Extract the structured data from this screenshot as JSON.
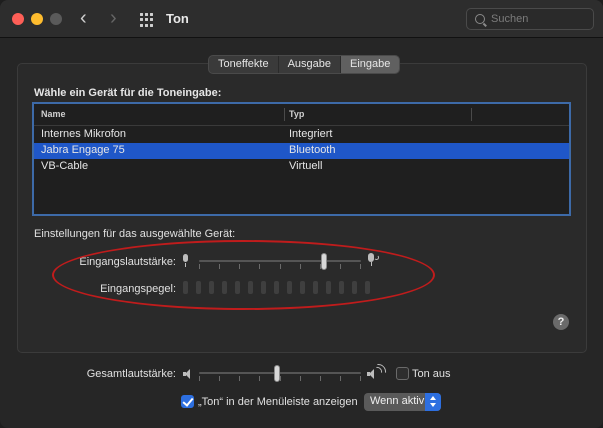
{
  "window": {
    "title": "Ton",
    "search_placeholder": "Suchen"
  },
  "tabs": [
    {
      "label": "Toneffekte",
      "selected": false
    },
    {
      "label": "Ausgabe",
      "selected": false
    },
    {
      "label": "Eingabe",
      "selected": true
    }
  ],
  "device_list": {
    "heading": "Wähle ein Gerät für die Toneingabe:",
    "columns": [
      "Name",
      "Typ"
    ],
    "rows": [
      {
        "name": "Internes Mikrofon",
        "type": "Integriert",
        "selected": false
      },
      {
        "name": "Jabra Engage 75",
        "type": "Bluetooth",
        "selected": true
      },
      {
        "name": "VB-Cable",
        "type": "Virtuell",
        "selected": false
      }
    ]
  },
  "selected_device_settings": {
    "heading": "Einstellungen für das ausgewählte Gerät:",
    "input_volume_label": "Eingangslautstärke:",
    "input_volume_level": 0.78,
    "input_level_label": "Eingangspegel:",
    "input_level_segments_lit": 0
  },
  "help_button": "?",
  "output": {
    "volume_label": "Gesamtlautstärke:",
    "volume_level": 0.48,
    "mute_label": "Ton aus",
    "mute_checked": false,
    "menubar_label": "„Ton“ in der Menüleiste anzeigen",
    "menubar_checked": true,
    "menubar_option": "Wenn aktiv"
  },
  "colors": {
    "selection": "#1f57c8",
    "accent": "#2d6fe0",
    "annotation": "#c01c1c"
  }
}
